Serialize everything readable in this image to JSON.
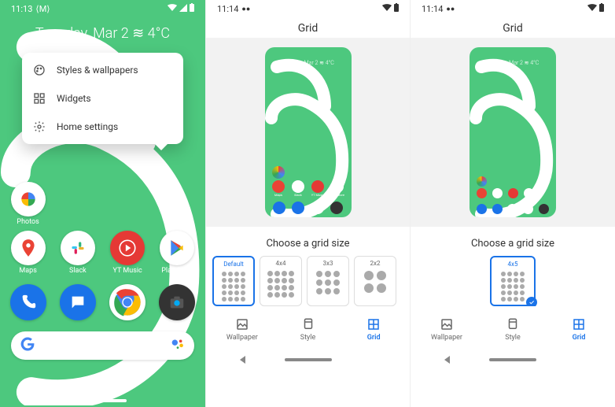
{
  "phone1": {
    "status": {
      "time": "11:13"
    },
    "date_weather": "Tuesday, Mar 2 ≋ 4°C",
    "menu": [
      {
        "label": "Styles & wallpapers"
      },
      {
        "label": "Widgets"
      },
      {
        "label": "Home settings"
      }
    ],
    "apps_row1": [
      {
        "label": "Photos"
      }
    ],
    "apps_row2": [
      {
        "label": "Maps"
      },
      {
        "label": "Slack"
      },
      {
        "label": "YT Music"
      },
      {
        "label": "Play Store"
      }
    ]
  },
  "phone2": {
    "status": {
      "time": "11:14"
    },
    "title": "Grid",
    "preview_date": "Tuesday, Mar 2 ≋ 4°C",
    "preview_apps": [
      "Photos",
      "Maps",
      "Slack",
      "YT Music",
      "Play Store"
    ],
    "choose_label": "Choose a grid size",
    "options": [
      {
        "label": "Default",
        "grid": "g45",
        "n": 20
      },
      {
        "label": "4x4",
        "grid": "g44",
        "n": 16
      },
      {
        "label": "3x3",
        "grid": "g33",
        "n": 9
      },
      {
        "label": "2x2",
        "grid": "g22",
        "n": 4
      }
    ],
    "selected_index": 0,
    "tabs": [
      {
        "label": "Wallpaper"
      },
      {
        "label": "Style"
      },
      {
        "label": "Grid"
      }
    ],
    "active_tab": 2
  },
  "phone3": {
    "status": {
      "time": "11:14"
    },
    "title": "Grid",
    "preview_date": "Tuesday, Mar 2 ≋ 4°C",
    "preview_apps": [
      "Photos",
      "Maps",
      "Slack",
      "YT Music",
      "Play Store"
    ],
    "choose_label": "Choose a grid size",
    "options": [
      {
        "label": "4x5",
        "grid": "g45",
        "n": 20
      }
    ],
    "selected_index": 0,
    "tabs": [
      {
        "label": "Wallpaper"
      },
      {
        "label": "Style"
      },
      {
        "label": "Grid"
      }
    ],
    "active_tab": 2
  }
}
